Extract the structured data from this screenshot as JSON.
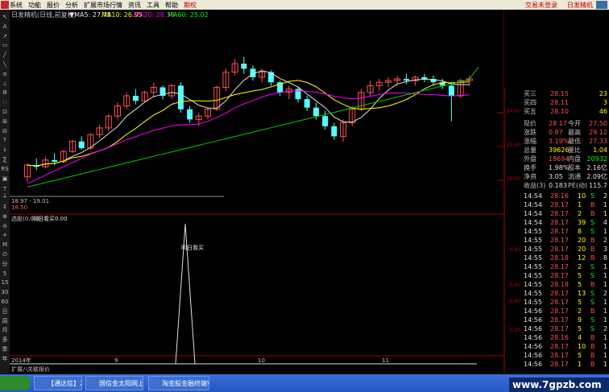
{
  "menu": [
    "系统",
    "功能",
    "报价",
    "分析",
    "扩展市场行情",
    "资讯",
    "工具",
    "帮助"
  ],
  "menu_highlight": "期权",
  "top_right": [
    "交易未登录",
    "日发精机"
  ],
  "left_tools": [
    "↖",
    "A",
    "↗",
    "▭",
    "╱",
    "╲",
    "≡",
    "⊥",
    "Ⅲ",
    "∷",
    "⊡",
    "⊞",
    "⊟",
    "↑",
    "↓",
    "∑",
    "RS",
    "▣",
    "┬",
    "┴",
    "↕",
    "⊕",
    "⊖",
    "+",
    "M",
    "∅",
    "分",
    "5",
    "15",
    "30",
    "60",
    "日",
    "周",
    "月",
    "多",
    "季",
    "年"
  ],
  "kline": {
    "title": "日发精机(日线,前复权)",
    "ma": [
      {
        "label": "▼MA5: 27.78",
        "color": "#e0e0e0"
      },
      {
        "label": "MA10: 26.95",
        "color": "#ffff00"
      },
      {
        "label": "MA20: 26.39",
        "color": "#ff00ff"
      },
      {
        "label": "MA60: 25.02",
        "color": "#00ff00"
      }
    ],
    "price_ticks": [
      "24.00",
      "22.00",
      "20.00"
    ],
    "low_labels": [
      "18.97 - 19.01",
      "18.50"
    ]
  },
  "indicator": {
    "title": "选股(0,0,0)",
    "name": "明日看买",
    "value": "0.00",
    "spike_label": "明日看买",
    "ticks": [
      "0.80",
      "0.60",
      "0.40",
      "0.20"
    ]
  },
  "date_axis": [
    "2014年",
    "9",
    "10",
    "11"
  ],
  "bottom_tabs": [
    "扩展八",
    "关联报价"
  ],
  "quote": {
    "asks": [
      {
        "label": "买三",
        "price": "28.15",
        "vol": "23"
      },
      {
        "label": "买四",
        "price": "28.11",
        "vol": "3"
      },
      {
        "label": "买五",
        "price": "28.10",
        "vol": "46"
      }
    ],
    "stats": [
      {
        "l1": "现价",
        "v1": "28.17",
        "l2": "今开",
        "v2": "27.50"
      },
      {
        "l1": "涨跌",
        "v1": "0.87",
        "l2": "最高",
        "v2": "29.12"
      },
      {
        "l1": "涨幅",
        "v1": "3.19%",
        "l2": "最低",
        "v2": "27.33"
      },
      {
        "l1": "总量",
        "v1": "39626",
        "l2": "量比",
        "v2": "1.04"
      },
      {
        "l1": "外盘",
        "v1": "18694",
        "l2": "内盘",
        "v2": "20932"
      },
      {
        "l1": "换手",
        "v1": "1.98%",
        "l2": "股本",
        "v2": "2.16亿"
      },
      {
        "l1": "净资",
        "v1": "3.05",
        "l2": "流通",
        "v2": "2.09亿"
      },
      {
        "l1": "收益(3)",
        "v1": "0.183",
        "l2": "PE(动)",
        "v2": "115.7"
      }
    ],
    "ticks": [
      {
        "t": "14:54",
        "p": "28.16",
        "v": "10",
        "s": "S",
        "c": "2"
      },
      {
        "t": "14:54",
        "p": "28.17",
        "v": "1",
        "s": "B",
        "c": "1"
      },
      {
        "t": "14:54",
        "p": "28.17",
        "v": "2",
        "s": "B",
        "c": "1"
      },
      {
        "t": "14:54",
        "p": "28.17",
        "v": "39",
        "s": "S",
        "c": "4"
      },
      {
        "t": "14:55",
        "p": "28.17",
        "v": "8",
        "s": "S",
        "c": "1"
      },
      {
        "t": "14:55",
        "p": "28.17",
        "v": "20",
        "s": "B",
        "c": "2"
      },
      {
        "t": "14:55",
        "p": "28.17",
        "v": "20",
        "s": "B",
        "c": "3"
      },
      {
        "t": "14:55",
        "p": "28.18",
        "v": "12",
        "s": "B",
        "c": "8"
      },
      {
        "t": "14:55",
        "p": "28.17",
        "v": "2",
        "s": "S",
        "c": "1"
      },
      {
        "t": "14:55",
        "p": "28.17",
        "v": "5",
        "s": "S",
        "c": "1"
      },
      {
        "t": "14:55",
        "p": "28.18",
        "v": "5",
        "s": "B",
        "c": "1"
      },
      {
        "t": "14:55",
        "p": "28.17",
        "v": "13",
        "s": "S",
        "c": "2"
      },
      {
        "t": "14:55",
        "p": "28.17",
        "v": "5",
        "s": "S",
        "c": "1"
      },
      {
        "t": "14:56",
        "p": "28.17",
        "v": "2",
        "s": "B",
        "c": "1"
      },
      {
        "t": "14:56",
        "p": "28.17",
        "v": "9",
        "s": "S",
        "c": "1"
      },
      {
        "t": "14:56",
        "p": "28.17",
        "v": "5",
        "s": "S",
        "c": "2"
      },
      {
        "t": "14:56",
        "p": "28.16",
        "v": "4",
        "s": "B",
        "c": "1"
      },
      {
        "t": "14:56",
        "p": "28.17",
        "v": "10",
        "s": "B",
        "c": "1"
      },
      {
        "t": "14:56",
        "p": "28.17",
        "v": "5",
        "s": "B",
        "c": "1"
      },
      {
        "t": "14:56",
        "p": "28.17",
        "v": "1",
        "s": "B",
        "c": "1"
      }
    ]
  },
  "taskbar": [
    "【通达信】2014...",
    "国信金太阳网上...",
    "淘金股金融终端V..."
  ],
  "watermark": "www.7gpzb.com"
}
